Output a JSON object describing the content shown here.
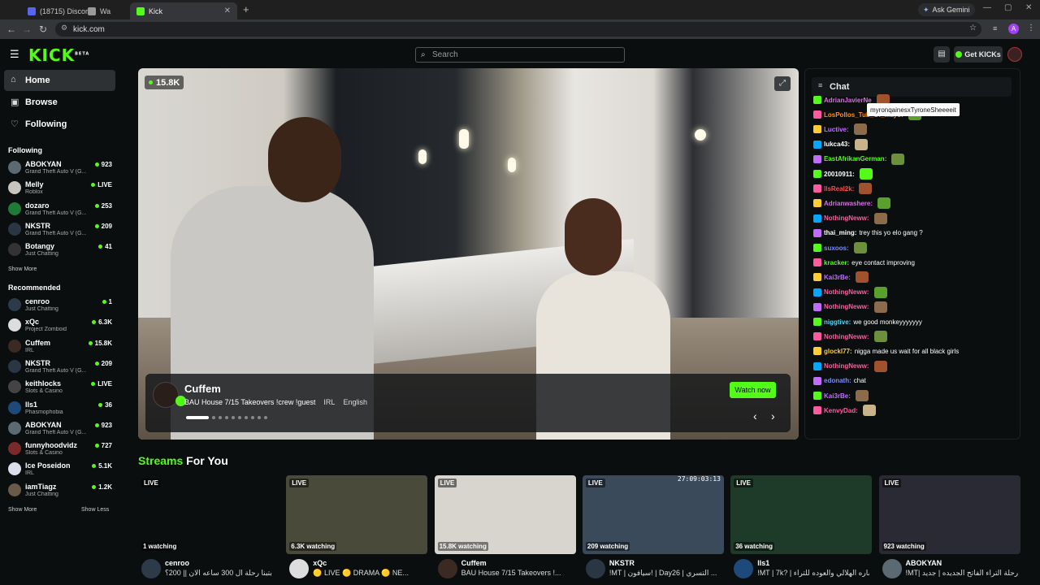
{
  "browser": {
    "tabs": [
      {
        "label": "(18715) Discord |",
        "active": false
      },
      {
        "label": "Wa",
        "active": false
      },
      {
        "label": "Kick",
        "active": true
      }
    ],
    "new_tab": "+",
    "url": "kick.com",
    "gemini": "Ask Gemini",
    "profile_initial": "A"
  },
  "header": {
    "logo": "KICK",
    "logo_sup": "BETA",
    "search_placeholder": "Search",
    "get_kicks": "Get KICKs"
  },
  "sidebar": {
    "nav": [
      {
        "label": "Home",
        "icon": "home-icon",
        "active": true
      },
      {
        "label": "Browse",
        "icon": "browse-icon",
        "active": false
      },
      {
        "label": "Following",
        "icon": "heart-icon",
        "active": false
      }
    ],
    "following_title": "Following",
    "following": [
      {
        "name": "ABOKYAN",
        "category": "Grand Theft Auto V (G...",
        "viewers": "923",
        "color": "#5b6a72"
      },
      {
        "name": "Melly",
        "category": "Roblox",
        "viewers": "LIVE",
        "color": "#c8c4be"
      },
      {
        "name": "dozaro",
        "category": "Grand Theft Auto V (G...",
        "viewers": "253",
        "color": "#1f7a36"
      },
      {
        "name": "NKSTR",
        "category": "Grand Theft Auto V (G...",
        "viewers": "209",
        "color": "#2a3644"
      },
      {
        "name": "Botangy",
        "category": "Just Chatting",
        "viewers": "41",
        "color": "#333"
      }
    ],
    "show_more_1": "Show More",
    "recommended_title": "Recommended",
    "recommended": [
      {
        "name": "cenroo",
        "category": "Just Chatting",
        "viewers": "1",
        "color": "#2c3a4a"
      },
      {
        "name": "xQc",
        "category": "Project Zomboid",
        "viewers": "6.3K",
        "color": "#ddd"
      },
      {
        "name": "Cuffem",
        "category": "IRL",
        "viewers": "15.8K",
        "color": "#3a2a22"
      },
      {
        "name": "NKSTR",
        "category": "Grand Theft Auto V (G...",
        "viewers": "209",
        "color": "#2a3644"
      },
      {
        "name": "keithlocks",
        "category": "Slots & Casino",
        "viewers": "LIVE",
        "color": "#444"
      },
      {
        "name": "lls1",
        "category": "Phasmophobia",
        "viewers": "36",
        "color": "#1d4a7a"
      },
      {
        "name": "ABOKYAN",
        "category": "Grand Theft Auto V (G...",
        "viewers": "923",
        "color": "#5b6a72"
      },
      {
        "name": "funnyhoodvidz",
        "category": "Slots & Casino",
        "viewers": "727",
        "color": "#7a2a2a"
      },
      {
        "name": "Ice Poseidon",
        "category": "IRL",
        "viewers": "5.1K",
        "color": "#dde"
      },
      {
        "name": "iamTiagz",
        "category": "Just Chatting",
        "viewers": "1.2K",
        "color": "#6a5a4a"
      }
    ],
    "show_more_2": "Show More",
    "show_less": "Show Less"
  },
  "player": {
    "viewers": "15.8K",
    "streamer": "Cuffem",
    "title": "BAU House 7/15 Takeovers !crew !guest",
    "tag1": "IRL",
    "tag2": "English",
    "watch_now": "Watch now",
    "prev": "‹",
    "next": "›"
  },
  "chat": {
    "title": "Chat",
    "tooltip": "myronqainesxTyroneSheeeeit",
    "messages": [
      {
        "user": "AdrianJavierNe",
        "color": "#d96ce0",
        "text": ""
      },
      {
        "user": "LosPollos_Tub_Of_Mayo:",
        "color": "#ff8c1a",
        "text": ""
      },
      {
        "user": "Luctive:",
        "color": "#c06cff",
        "text": ""
      },
      {
        "user": "lukca43:",
        "color": "#ffffff",
        "text": ""
      },
      {
        "user": "EastAfrikanGerman:",
        "color": "#53fc18",
        "text": ""
      },
      {
        "user": "20010911:",
        "color": "#ffffff",
        "text": ""
      },
      {
        "user": "llsReal2k:",
        "color": "#ff4a4a",
        "text": ""
      },
      {
        "user": "Adrianwashere:",
        "color": "#d96ce0",
        "text": ""
      },
      {
        "user": "NothingNeww:",
        "color": "#ff5aa0",
        "text": ""
      },
      {
        "user": "thai_ming:",
        "color": "#ffffff",
        "text": "trey this yo elo gang ?"
      },
      {
        "user": "suxoos:",
        "color": "#7a8cff",
        "text": ""
      },
      {
        "user": "kracker:",
        "color": "#53fc18",
        "text": "eye contact improving"
      },
      {
        "user": "Kai3rBe:",
        "color": "#c06cff",
        "text": ""
      },
      {
        "user": "NothingNeww:",
        "color": "#ff5aa0",
        "text": ""
      },
      {
        "user": "NothingNeww:",
        "color": "#ff5aa0",
        "text": ""
      },
      {
        "user": "niggtive:",
        "color": "#4ad9ff",
        "text": "we good monkeyyyyyyy"
      },
      {
        "user": "NothingNeww:",
        "color": "#ff5aa0",
        "text": ""
      },
      {
        "user": "glockl77:",
        "color": "#ffcc33",
        "text": "nigga made us wait for all black girls"
      },
      {
        "user": "NothingNeww:",
        "color": "#ff5aa0",
        "text": ""
      },
      {
        "user": "edonath:",
        "color": "#7a8cff",
        "text": "chat"
      },
      {
        "user": "Kai3rBe:",
        "color": "#c06cff",
        "text": ""
      },
      {
        "user": "KenvyDad:",
        "color": "#ff5aa0",
        "text": ""
      }
    ]
  },
  "streams": {
    "title_hl": "Streams",
    "title_rest": "For You",
    "cards": [
      {
        "live": "LIVE",
        "watching": "1 watching",
        "name": "cenroo",
        "title": "بتبنا رحلة ال 300 ساعه الان || 200؟",
        "thumb": "#0b0e0f",
        "avatar": "#2c3a4a",
        "stamp": ""
      },
      {
        "live": "LIVE",
        "watching": "6.3K watching",
        "name": "xQc",
        "title": "🟡 LIVE 🟡 DRAMA 🟡 NE...",
        "thumb": "#4a4a3a",
        "avatar": "#ddd",
        "stamp": ""
      },
      {
        "live": "LIVE",
        "watching": "15.8K watching",
        "name": "Cuffem",
        "title": "BAU House 7/15 Takeovers !...",
        "thumb": "#d8d5ce",
        "avatar": "#3a2a22",
        "stamp": ""
      },
      {
        "live": "LIVE",
        "watching": "209 watching",
        "name": "NKSTR",
        "title": "!MT | سيافون! | Day26 | التسري ...",
        "thumb": "#3a4a5a",
        "avatar": "#2a3644",
        "stamp": "27:09:03:13"
      },
      {
        "live": "LIVE",
        "watching": "36 watching",
        "name": "lls1",
        "title": "!MT | 7k? | ساره الهلالي والعوده للتراء",
        "thumb": "#1e3a28",
        "avatar": "#1d4a7a",
        "stamp": ""
      },
      {
        "live": "LIVE",
        "watching": "923 watching",
        "name": "ABOKYAN",
        "title": "!MT| رحلة التراء الفاتح الجديده | جديد",
        "thumb": "#2a2a34",
        "avatar": "#5b6a72",
        "stamp": ""
      }
    ]
  }
}
